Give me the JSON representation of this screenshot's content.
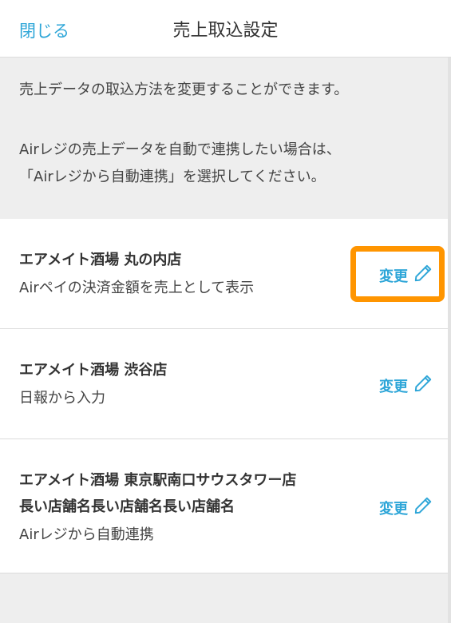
{
  "header": {
    "close_label": "閉じる",
    "title": "売上取込設定"
  },
  "intro": {
    "line1": "売上データの取込方法を変更することができます。",
    "line2": "Airレジの売上データを自動で連携したい場合は、",
    "line3": "「Airレジから自動連携」を選択してください。"
  },
  "stores": [
    {
      "name_lines": [
        "エアメイト酒場 丸の内店"
      ],
      "method": "Airペイの決済金額を売上として表示",
      "change_label": "変更"
    },
    {
      "name_lines": [
        "エアメイト酒場 渋谷店"
      ],
      "method": "日報から入力",
      "change_label": "変更"
    },
    {
      "name_lines": [
        "エアメイト酒場 東京駅南口サウスタワー店",
        "長い店舗名長い店舗名長い店舗名"
      ],
      "method": "Airレジから自動連携",
      "change_label": "変更"
    }
  ],
  "colors": {
    "accent": "#2ea6d8",
    "highlight": "#ff9500",
    "background": "#eeeeee"
  },
  "icons": {
    "edit": "pencil-icon"
  }
}
